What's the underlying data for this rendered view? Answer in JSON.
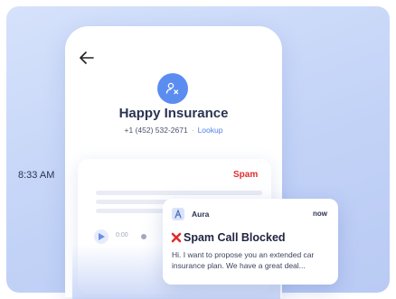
{
  "contact": {
    "name": "Happy Insurance",
    "phone": "+1 (452) 532-2671",
    "separator": "·",
    "lookup_label": "Lookup"
  },
  "call_card": {
    "time": "8:33 AM",
    "status": "Spam",
    "player_time": "0:00"
  },
  "notification": {
    "app_name": "Aura",
    "time": "now",
    "title": "Spam Call Blocked",
    "body": "Hi. I want to propose you an extended car insurance plan. We have a great deal..."
  },
  "colors": {
    "accent": "#5b8df1",
    "spam": "#e02d2d",
    "background": "#c3d3f7"
  },
  "icons": [
    "back-arrow-icon",
    "contact-unknown-icon",
    "play-icon",
    "aura-app-icon",
    "cross-mark-icon"
  ]
}
